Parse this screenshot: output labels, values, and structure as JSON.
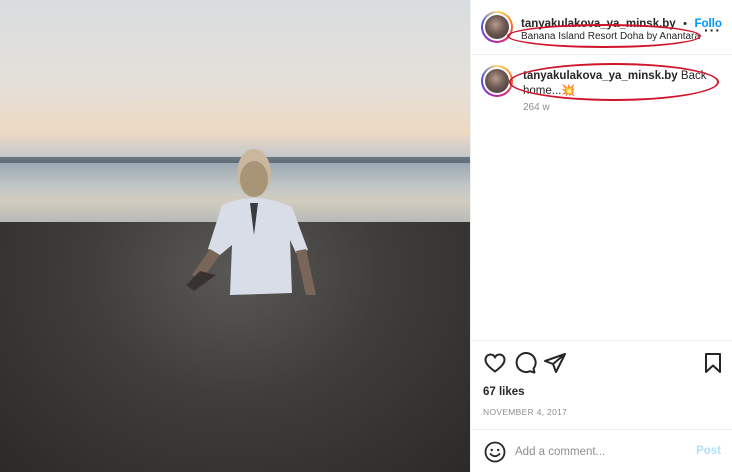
{
  "post": {
    "username": "tanyakulakova_ya_minsk.by",
    "separator": "•",
    "follow_label": "Follo",
    "location": "Banana Island Resort Doha by Anantara",
    "more_icon": "more-horizontal-icon"
  },
  "caption": {
    "username": "tanyakulakova_ya_minsk.by",
    "text": "Back home...",
    "emoji": "💥",
    "age": "264 w"
  },
  "actions": {
    "like_icon": "heart-icon",
    "comment_icon": "comment-icon",
    "share_icon": "send-icon",
    "save_icon": "bookmark-icon",
    "likes": "67 likes",
    "date": "NOVEMBER 4, 2017"
  },
  "add_comment": {
    "emoji_icon": "smiley-icon",
    "placeholder": "Add a comment...",
    "post_label": "Post"
  },
  "colors": {
    "accent": "#0095f6",
    "annotation": "#d0142a",
    "muted": "#8e8e8e"
  }
}
